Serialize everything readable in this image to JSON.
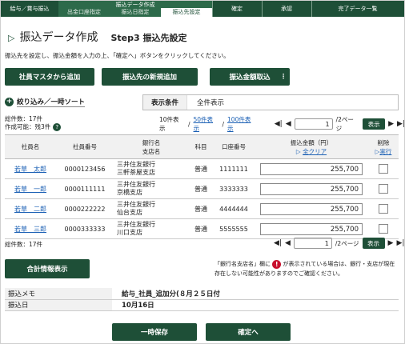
{
  "steps": {
    "step1": "給与／賞与振込",
    "group_title": "振込データ作成",
    "sub1": "出金口座指定",
    "sub2": "振込日指定",
    "sub3": "振込先設定",
    "step3": "確定",
    "step4": "承認",
    "step5": "完了データ一覧"
  },
  "header": {
    "title": "振込データ作成",
    "subtitle": "Step3 振込先設定",
    "instruction": "振込先を設定し、振込金額を入力の上、「確定へ」ボタンをクリックしてください。"
  },
  "actions": {
    "add_from_master": "社員マスタから追加",
    "add_new_payee": "振込先の新規追加",
    "import_amount": "振込金額取込",
    "more": "⋮"
  },
  "filter": {
    "label": "絞り込み／一時ソート",
    "icon": "+"
  },
  "condition": {
    "label": "表示条件",
    "value": "全件表示"
  },
  "summary": {
    "total": "総件数：17件",
    "draft": "作成可能：残3件",
    "help": "?"
  },
  "pager_top": {
    "per10": "10件表示",
    "per50": "50件表示",
    "per100": "100件表示",
    "sep": "/",
    "page": "1",
    "of_pages": "/2ページ",
    "display": "表示"
  },
  "table": {
    "headers": {
      "name": "社員名",
      "number": "社員番号",
      "bank": "銀行名\n支店名",
      "type": "科目",
      "account": "口座番号",
      "amount": "振込金額（円）",
      "clear_all": "全クリア",
      "delete": "削除",
      "execute": "実行"
    },
    "rows": [
      {
        "name": "若草　太郎",
        "number": "0000123456",
        "bank": "三井住友銀行",
        "branch": "三軒茶屋支店",
        "type": "普通",
        "account": "1111111",
        "amount": "255,700"
      },
      {
        "name": "若草　一郎",
        "number": "0000111111",
        "bank": "三井住友銀行",
        "branch": "京橋支店",
        "type": "普通",
        "account": "3333333",
        "amount": "255,700"
      },
      {
        "name": "若草　二郎",
        "number": "0000222222",
        "bank": "三井住友銀行",
        "branch": "仙台支店",
        "type": "普通",
        "account": "4444444",
        "amount": "255,700"
      },
      {
        "name": "若草　三郎",
        "number": "0000333333",
        "bank": "三井住友銀行",
        "branch": "川口支店",
        "type": "普通",
        "account": "5555555",
        "amount": "255,700"
      }
    ]
  },
  "summary_bottom": {
    "total": "総件数：17件"
  },
  "pager_bottom": {
    "page": "1",
    "of_pages": "/2ページ",
    "display": "表示"
  },
  "totals_button": "合計情報表示",
  "note": {
    "before": "「銀行名支店名」欄に",
    "after": "が表示されている場合は、銀行・支店が現在存在しない可能性がありますのでご確認ください。"
  },
  "info": {
    "memo_label": "振込メモ",
    "memo_value": "給与_社員_追加分(８月２５日付",
    "date_label": "振込日",
    "date_value": "10月16日"
  },
  "footer": {
    "save": "一時保存",
    "confirm": "確定へ"
  }
}
